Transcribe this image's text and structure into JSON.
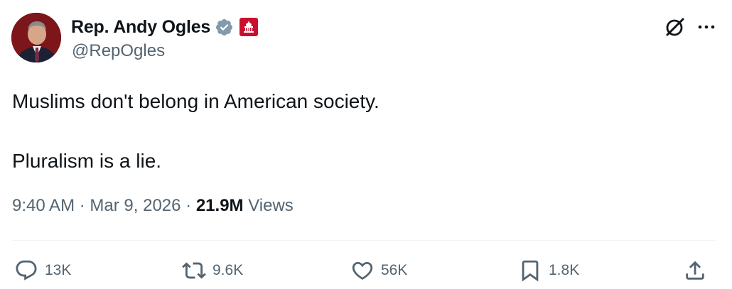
{
  "author": {
    "display_name": "Rep. Andy Ogles",
    "handle": "@RepOgles",
    "avatar_icon": "profile-photo",
    "verified_icon": "verified-badge-icon",
    "affiliation_icon": "us-government-badge-icon",
    "verified_color": "#829aab",
    "affiliation_color": "#c8102e"
  },
  "header_icons": [
    "grok-icon",
    "more-icon"
  ],
  "tweet": {
    "paragraphs": [
      "Muslims don't belong in American society.",
      "Pluralism is a lie."
    ]
  },
  "meta": {
    "time": "9:40 AM",
    "separator": "·",
    "date": "Mar 9, 2026",
    "views_count": "21.9M",
    "views_label": "Views"
  },
  "actions": {
    "replies": "13K",
    "reposts": "9.6K",
    "likes": "56K",
    "bookmarks": "1.8K"
  },
  "colors": {
    "text": "#0f1419",
    "secondary": "#536471",
    "divider": "#eff3f4"
  }
}
